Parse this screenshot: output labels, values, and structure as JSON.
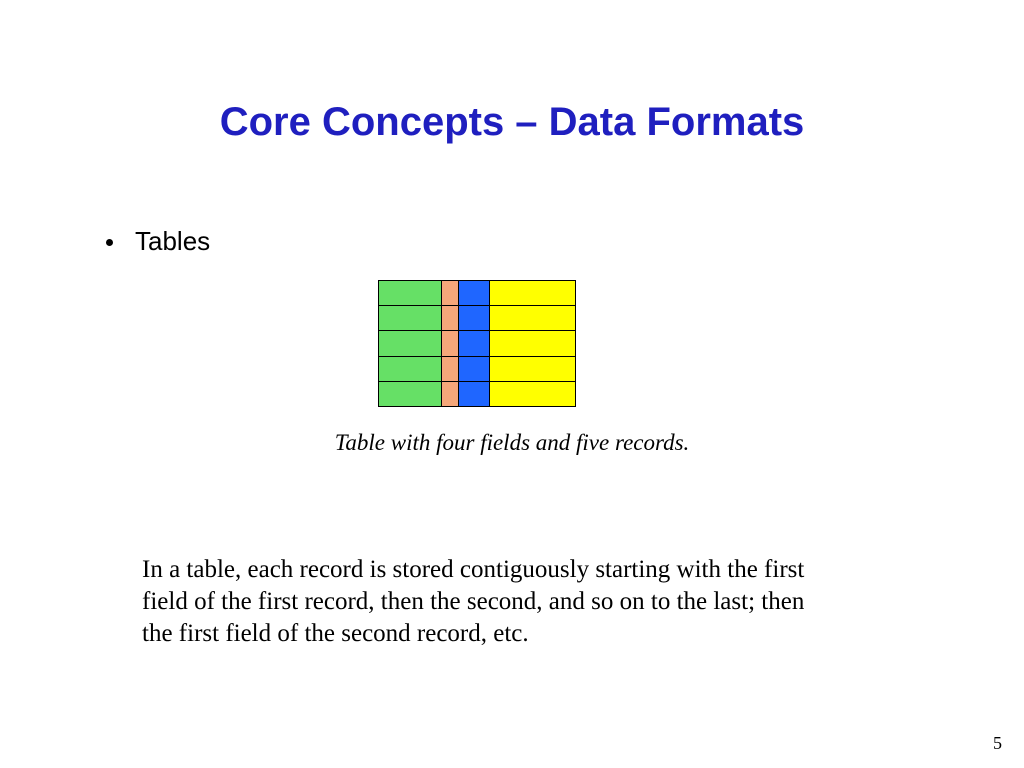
{
  "title": "Core Concepts – Data Formats",
  "bullet": "Tables",
  "figure": {
    "rows": 5,
    "columns": [
      {
        "width_class": "c1",
        "color": "#66e066"
      },
      {
        "width_class": "c2",
        "color": "#f5a77a"
      },
      {
        "width_class": "c3",
        "color": "#1f66ff"
      },
      {
        "width_class": "c4",
        "color": "#ffff00"
      }
    ]
  },
  "caption": "Table with four fields and five records.",
  "body": "In a table, each record is stored contiguously starting with the first field of the first record, then the second, and so on to the last; then the first field of the second record, etc.",
  "page_number": "5"
}
